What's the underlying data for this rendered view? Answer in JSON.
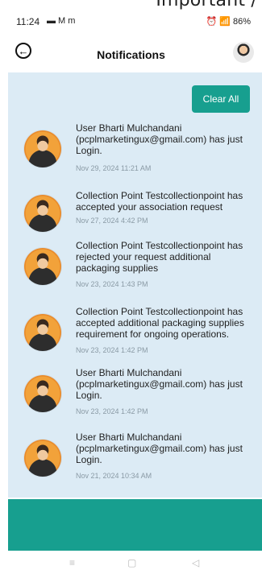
{
  "overlay": {
    "text": "Important /"
  },
  "status_bar": {
    "time": "11:24",
    "left_icons": "▬ M m",
    "right_icons": "⏰ 📶 86%"
  },
  "header": {
    "back_icon": "arrow-left-circle-icon",
    "title": "Notifications",
    "avatar": "profile-avatar"
  },
  "actions": {
    "clear_all": "Clear All"
  },
  "notifications": [
    {
      "text": "User Bharti Mulchandani (pcplmarketingux@gmail.com) has just Login.",
      "time": "Nov 29, 2024 11:21 AM"
    },
    {
      "text": "Collection Point Testcollectionpoint has accepted your association request",
      "time": "Nov 27, 2024 4:42 PM"
    },
    {
      "text": "Collection Point Testcollectionpoint has rejected your request additional packaging supplies",
      "time": "Nov 23, 2024 1:43 PM"
    },
    {
      "text": "Collection Point Testcollectionpoint has accepted additional packaging supplies requirement for ongoing operations.",
      "time": "Nov 23, 2024 1:42 PM"
    },
    {
      "text": "User Bharti Mulchandani (pcplmarketingux@gmail.com) has just Login.",
      "time": "Nov 23, 2024 1:42 PM"
    },
    {
      "text": "User Bharti Mulchandani (pcplmarketingux@gmail.com) has just Login.",
      "time": "Nov 21, 2024 10:34 AM"
    }
  ],
  "nav": {
    "menu": "≡",
    "home": "▢",
    "back": "◁"
  },
  "colors": {
    "accent": "#179f8f",
    "panel": "#dcebf5"
  }
}
